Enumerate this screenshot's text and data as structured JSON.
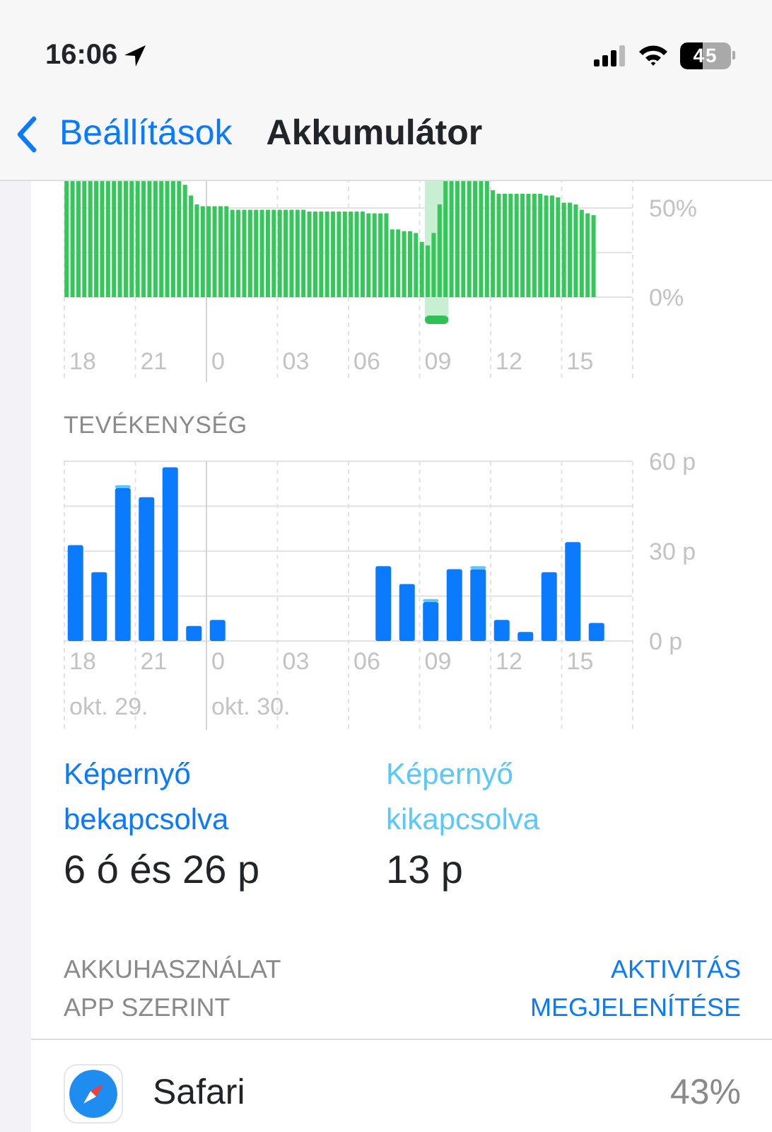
{
  "status_bar": {
    "time": "16:06",
    "battery_text": "45"
  },
  "nav": {
    "back_label": "Beállítások",
    "title": "Akkumulátor"
  },
  "battery_chart": {
    "y_labels": [
      "50%",
      "0%"
    ],
    "x_labels": [
      "18",
      "21",
      "0",
      "03",
      "06",
      "09",
      "12",
      "15"
    ]
  },
  "activity": {
    "title": "TEVÉKENYSÉG",
    "chart_data": {
      "type": "bar",
      "stacked": true,
      "ylim": [
        0,
        60
      ],
      "yticks": [
        {
          "value": 0,
          "label": "0 p"
        },
        {
          "value": 30,
          "label": "30 p"
        },
        {
          "value": 60,
          "label": "60 p"
        }
      ],
      "categories": [
        "18",
        null,
        null,
        "21",
        null,
        null,
        "0",
        null,
        null,
        "03",
        null,
        null,
        "06",
        null,
        null,
        "09",
        null,
        null,
        "12",
        null,
        null,
        "15",
        null
      ],
      "series": [
        {
          "color": "#0a7aff",
          "values": [
            32,
            23,
            51,
            48,
            58,
            5,
            7,
            0,
            0,
            0,
            0,
            0,
            0,
            25,
            19,
            13,
            24,
            24,
            7,
            3,
            23,
            33,
            6
          ]
        },
        {
          "color": "#5ac8fa",
          "values": [
            0,
            0,
            1,
            0,
            0,
            0,
            0,
            0,
            0,
            0,
            0,
            0,
            0,
            0,
            0,
            1,
            0,
            1,
            0,
            0,
            0,
            0,
            0
          ]
        }
      ],
      "annotations": [
        "okt. 29.",
        "okt. 30."
      ]
    }
  },
  "screen_stats": [
    {
      "kind": "on",
      "label": "Képernyő bekapcsolva",
      "value": "6 ó és 26 p"
    },
    {
      "kind": "off",
      "label": "Képernyő kikapcsolva",
      "value": "13 p"
    }
  ],
  "usage_header": {
    "title": "AKKUHASZNÁLAT APP SZERINT",
    "action": "AKTIVITÁS MEGJELENÍTÉSE"
  },
  "apps": [
    {
      "name": "Safari",
      "percent": "43%"
    }
  ]
}
